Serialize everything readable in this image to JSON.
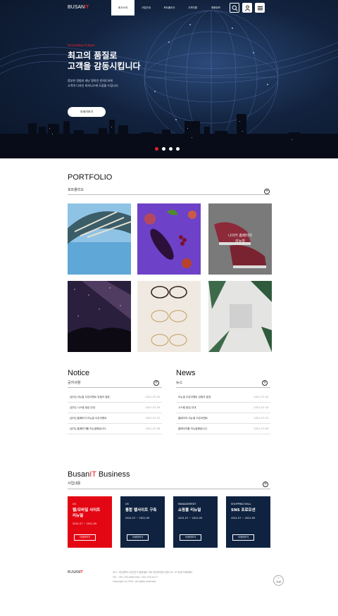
{
  "header": {
    "logo_main": "BUSAN",
    "logo_accent": "IT",
    "menu": [
      {
        "label": "회사소개",
        "active": true
      },
      {
        "label": "사업안내",
        "active": false
      },
      {
        "label": "포트폴리오",
        "active": false
      },
      {
        "label": "고객지원",
        "active": false
      },
      {
        "label": "채용정보",
        "active": false
      }
    ],
    "icons": [
      "search-icon",
      "user-icon",
      "menu-icon"
    ]
  },
  "hero": {
    "kicker": "Innovative Future",
    "title_line1": "최고의 품질로",
    "title_line2": "고객을 감동시킵니다",
    "desc_line1": "풍부한 경험과 새난 정의인 안의도하게",
    "desc_line2": "고객의 디자인 비지니스에 도움을 드립니다.",
    "button": "자세히보기",
    "slides": 4,
    "active_slide": 0
  },
  "portfolio": {
    "title": "PORTFOLIO",
    "subtitle": "포트폴리오",
    "items": [
      {
        "label": "",
        "image": "umbrella-sky-photo"
      },
      {
        "label": "",
        "image": "fruits-on-purple-photo"
      },
      {
        "label_line1": "나이키 홈페이지",
        "label_line2": "리뉴얼",
        "image": "red-sneakers-photo"
      },
      {
        "label": "",
        "image": "night-sky-photo"
      },
      {
        "label": "",
        "image": "eyeglasses-photo"
      },
      {
        "label": "",
        "image": "plant-card-photo"
      }
    ]
  },
  "notice": {
    "title": "Notice",
    "subtitle": "공지사항",
    "rows": [
      {
        "text": "[공지] 리뉴얼 오픈이벤트 당첨자 발표",
        "date": "2021.07.20"
      },
      {
        "text": "[공지] 시스템 점검 안내",
        "date": "2021.07.18"
      },
      {
        "text": "[공지] 홈페이지 리뉴얼 오픈이벤트",
        "date": "2021.07.15"
      },
      {
        "text": "[공지] 홈페이지를 리뉴얼했습니다.",
        "date": "2021.07.08"
      }
    ]
  },
  "news": {
    "title": "News",
    "subtitle": "뉴스",
    "rows": [
      {
        "text": "리뉴얼 오픈이벤트 당첨자 발표",
        "date": "2021.07.20"
      },
      {
        "text": "시스템 점검 안내",
        "date": "2021.07.18"
      },
      {
        "text": "홈페이지 리뉴얼 오픈이벤트",
        "date": "2021.07.15"
      },
      {
        "text": "홈페이지를 리뉴얼했습니다.",
        "date": "2021.07.08"
      }
    ]
  },
  "business": {
    "title_main": "Busan",
    "title_accent": "IT",
    "title_rest": "Business",
    "subtitle": "사업내용",
    "cards": [
      {
        "category": "UX",
        "name_line1": "웹/모바일 사이트",
        "name_line2": "리뉴얼",
        "period": "2021.07 ~ 2021.09",
        "button": "자세히보기",
        "color": "#e30613"
      },
      {
        "category": "UX",
        "name_line1": "통합 웹사이트 구축",
        "name_line2": "",
        "period": "2021.07 ~ 2021.09",
        "button": "자세히보기",
        "color": "#0f2340"
      },
      {
        "category": "MANAGEMENT",
        "name_line1": "쇼핑몰 리뉴얼",
        "name_line2": "",
        "period": "2021.07 ~ 2021.09",
        "button": "자세히보기",
        "color": "#0f2340"
      },
      {
        "category": "SHOPPING MALL",
        "name_line1": "SNS 프로모션",
        "name_line2": "",
        "period": "2021.07 ~ 2021.09",
        "button": "자세히보기",
        "color": "#0f2340"
      }
    ]
  },
  "footer": {
    "logo_main": "BUSAN",
    "logo_accent": "IT",
    "address": "주소 : 부산광역시 부산진구 중앙대로 708 부산파이낸스센터 4F, 5F 부산IT교육센터",
    "phone": "TEL : 051-753-5600     FAX : 051-753-5177",
    "copyright": "Copyright (c) 2021. All rights reserved.",
    "top_button": "TOP"
  }
}
